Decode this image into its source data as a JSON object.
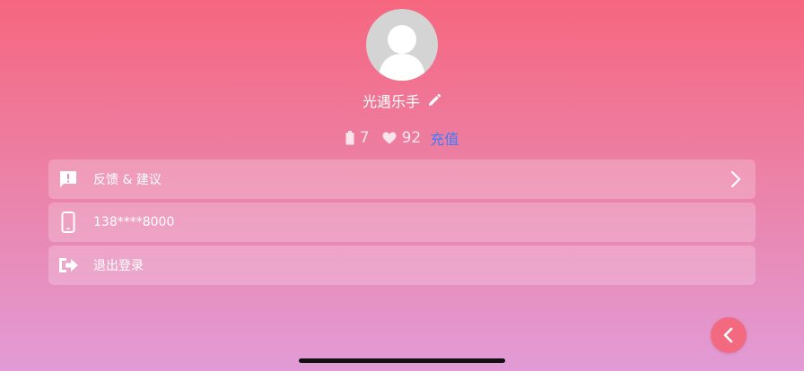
{
  "profile": {
    "username": "光遇乐手"
  },
  "stats": {
    "battery_count": "7",
    "heart_count": "92",
    "recharge_label": "充值"
  },
  "menu": {
    "feedback_label": "反馈 & 建议",
    "phone_label": "138****8000",
    "logout_label": "退出登录"
  },
  "icons": {
    "avatar": "avatar-placeholder-icon",
    "edit": "pencil-icon",
    "battery": "battery-icon",
    "heart": "heart-icon",
    "feedback": "feedback-icon",
    "phone": "phone-icon",
    "logout": "logout-icon",
    "chevron": "chevron-right-icon",
    "back": "chevron-left-icon"
  },
  "colors": {
    "background_top": "#f6667f",
    "background_bottom": "#e29bd6",
    "recharge_link": "#3f7bff",
    "back_button": "#f36a80"
  }
}
